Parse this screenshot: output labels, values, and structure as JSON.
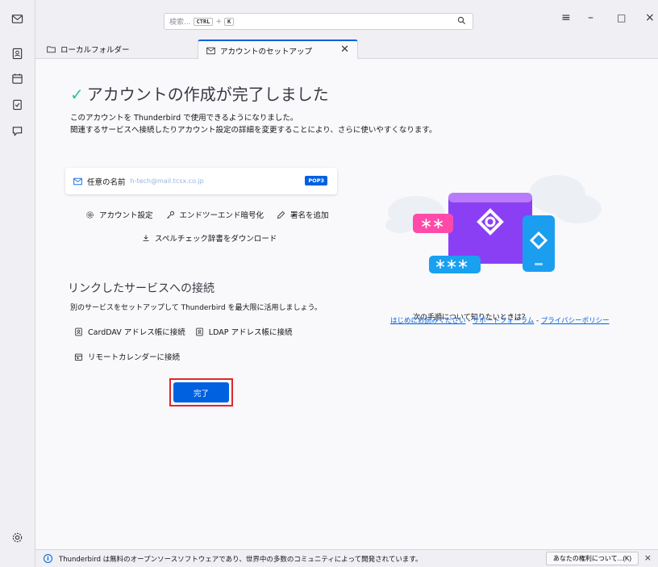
{
  "window": {
    "search_placeholder": "検索...",
    "shortcut_ctrl": "CTRL",
    "shortcut_plus": "+",
    "shortcut_key": "K",
    "menu_glyph": "≡",
    "minimize_glyph": "–",
    "maximize_glyph": "□",
    "close_glyph": "×"
  },
  "tabs": [
    {
      "label": "ローカルフォルダー",
      "icon": "folder-icon"
    },
    {
      "label": "アカウントのセットアップ",
      "icon": "account-setup-icon",
      "close": "✕"
    }
  ],
  "main": {
    "check": "✓",
    "title": "アカウントの作成が完了しました",
    "desc1": "このアカウントを Thunderbird で使用できるようになりました。",
    "desc2": "関連するサービスへ接続したりアカウント設定の詳細を変更することにより、さらに使いやすくなります。",
    "account": {
      "name_label": "任意の名前",
      "email": "h-tech@mail.tcsx.co.jp",
      "type_badge": "POP3"
    },
    "actions": [
      {
        "label": "アカウント設定",
        "icon": "gear-icon"
      },
      {
        "label": "エンドツーエンド暗号化",
        "icon": "key-icon"
      },
      {
        "label": "署名を追加",
        "icon": "pen-icon"
      }
    ],
    "spellcheck": "スペルチェック辞書をダウンロード",
    "linked_title": "リンクしたサービスへの接続",
    "linked_desc": "別のサービスをセットアップして Thunderbird を最大限に活用しましょう。",
    "services": [
      {
        "label": "CardDAV アドレス帳に接続",
        "icon": "address-book-icon"
      },
      {
        "label": "LDAP アドレス帳に接続",
        "icon": "address-book-icon"
      }
    ],
    "calendar": "リモートカレンダーに接続",
    "done_button": "完了",
    "next_steps_title": "次の手順について知りたいときは？",
    "links": [
      "はじめにお読みください",
      "サポートフォーラム",
      "プライバシーポリシー"
    ],
    "link_separator": " - "
  },
  "status": {
    "info_glyph": "i",
    "message": "Thunderbird は無料のオープンソースソフトウェアであり、世界中の多数のコミュニティによって開発されています。",
    "rights_button": "あなたの権利について...(K)",
    "close_glyph": "×"
  },
  "colors": {
    "accent": "#0061e0",
    "check": "#2ac3a2",
    "highlight": "#e0262e"
  }
}
